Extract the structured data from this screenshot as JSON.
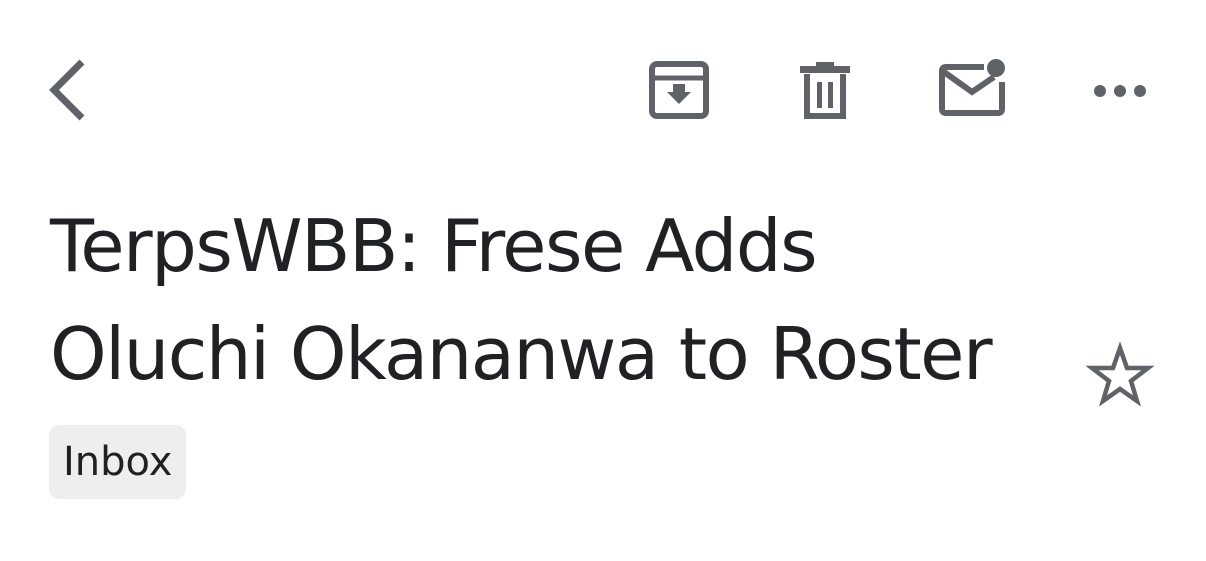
{
  "toolbar": {
    "back_icon": "chevron-left-icon",
    "archive_icon": "archive-icon",
    "delete_icon": "trash-icon",
    "mark_unread_icon": "mail-unread-icon",
    "more_icon": "more-horizontal-icon",
    "icon_color": "#5f6368"
  },
  "email": {
    "subject": "TerpsWBB: Frese Adds Oluchi Okananwa to Roster",
    "label": "Inbox",
    "star_icon": "star-outline-icon",
    "starred": false
  },
  "colors": {
    "background": "#ffffff",
    "text": "#202124",
    "chip_background": "#eeeeee"
  }
}
